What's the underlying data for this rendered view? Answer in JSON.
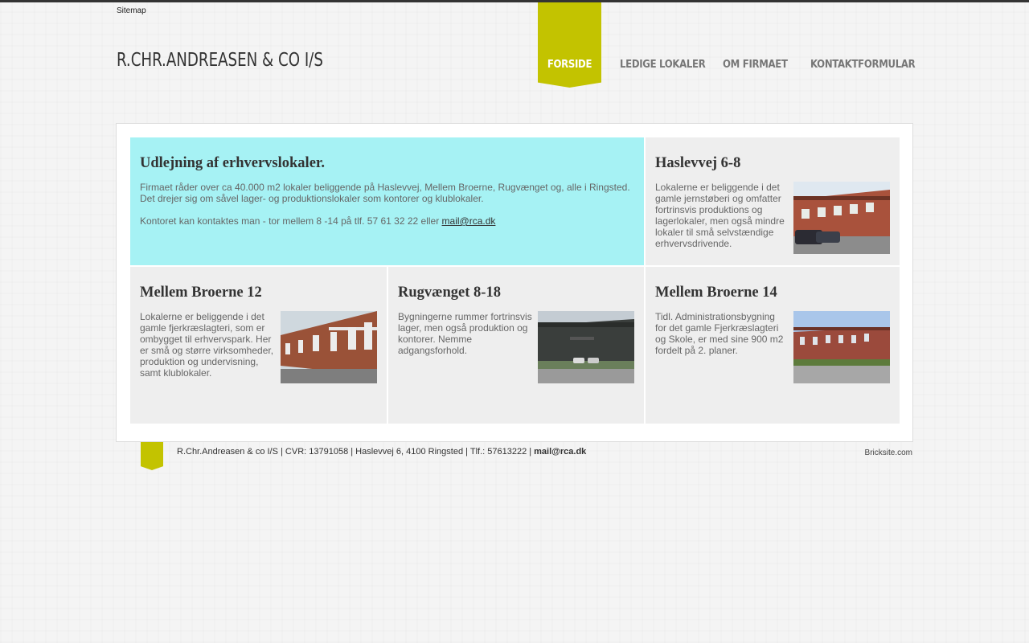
{
  "header": {
    "sitemap_label": "Sitemap",
    "logo_text": "R.CHR.ANDREASEN & CO I/S"
  },
  "nav": {
    "items": [
      {
        "label": "FORSIDE",
        "active": true
      },
      {
        "label": "LEDIGE LOKALER",
        "active": false
      },
      {
        "label": "OM FIRMAET",
        "active": false
      },
      {
        "label": "KONTAKTFORMULAR",
        "active": false
      }
    ]
  },
  "intro": {
    "title": "Udlejning af erhvervslokaler.",
    "paragraph1": "Firmaet råder over ca 40.000 m2 lokaler beliggende på Haslevvej, Mellem Broerne, Rugvænget og, alle i Ringsted. Det drejer sig om såvel lager- og produktionslokaler som kontorer og klublokaler.",
    "paragraph2_prefix": "Kontoret kan kontaktes man - tor mellem 8 -14 på tlf. 57 61 32 22 eller ",
    "email_link": "mail@rca.dk"
  },
  "properties": [
    {
      "title": "Haslevvej 6-8",
      "text": "Lokalerne er beliggende i det gamle jernstøberi og omfatter fortrinsvis produktions og lagerlokaler, men også mindre lokaler til små selvstændige erhvervsdrivende."
    },
    {
      "title": "Mellem Broerne 12",
      "text": "Lokalerne er beliggende i det gamle fjerkræslagteri, som er ombygget til erhvervspark. Her er små og større virksomheder, produktion og undervisning, samt klublokaler."
    },
    {
      "title": "Rugvænget 8-18",
      "text": "Bygningerne rummer fortrinsvis lager, men også produktion og kontorer. Nemme adgangsforhold."
    },
    {
      "title": "Mellem Broerne 14",
      "text": "Tidl. Administrationsbygning for det gamle Fjerkræslagteri og Skole, er med sine 900 m2 fordelt på 2. planer."
    }
  ],
  "footer": {
    "text": "R.Chr.Andreasen & co I/S | CVR: 13791058 | Haslevvej 6, 4100 Ringsted  | Tlf.: 57613222 | ",
    "email": "mail@rca.dk",
    "bricksite": "Bricksite.com"
  },
  "colors": {
    "accent": "#c3c300",
    "highlight_box": "#a6f2f4",
    "box": "#eeeeee"
  }
}
